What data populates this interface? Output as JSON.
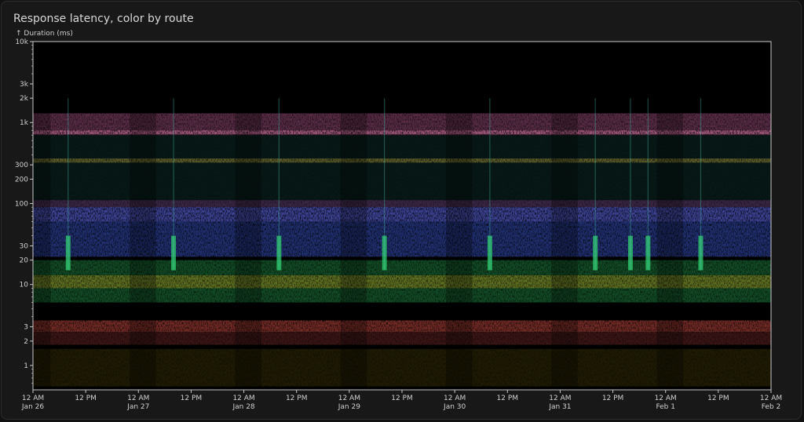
{
  "panel": {
    "title": "Response latency, color by route",
    "y_axis_title": "↑ Duration (ms)"
  },
  "colors": {
    "background": "#000000",
    "panel_bg": "#181818",
    "axis": "#c8c8c8",
    "text": "#d0d0d0"
  },
  "chart_data": {
    "type": "heatmap",
    "title": "Response latency, color by route",
    "ylabel": "↑ Duration (ms)",
    "xlabel": "",
    "y_scale": "log",
    "ylim": [
      0.5,
      10000
    ],
    "xlim": [
      "Jan 26 12 AM",
      "Feb 2 12 AM"
    ],
    "y_tick_values": [
      1,
      2,
      3,
      10,
      20,
      30,
      100,
      200,
      300,
      1000,
      2000,
      3000,
      10000
    ],
    "y_tick_labels": [
      "1",
      "2",
      "3",
      "10",
      "20",
      "30",
      "100",
      "200",
      "300",
      "1k",
      "2k",
      "3k",
      "10k"
    ],
    "x_ticks": [
      {
        "hour": 0,
        "line1": "12 AM",
        "line2": "Jan 26"
      },
      {
        "hour": 12,
        "line1": "12 PM",
        "line2": ""
      },
      {
        "hour": 24,
        "line1": "12 AM",
        "line2": "Jan 27"
      },
      {
        "hour": 36,
        "line1": "12 PM",
        "line2": ""
      },
      {
        "hour": 48,
        "line1": "12 AM",
        "line2": "Jan 28"
      },
      {
        "hour": 60,
        "line1": "12 PM",
        "line2": ""
      },
      {
        "hour": 72,
        "line1": "12 AM",
        "line2": "Jan 29"
      },
      {
        "hour": 84,
        "line1": "12 PM",
        "line2": ""
      },
      {
        "hour": 96,
        "line1": "12 AM",
        "line2": "Jan 30"
      },
      {
        "hour": 108,
        "line1": "12 PM",
        "line2": ""
      },
      {
        "hour": 120,
        "line1": "12 AM",
        "line2": "Jan 31"
      },
      {
        "hour": 132,
        "line1": "12 PM",
        "line2": ""
      },
      {
        "hour": 144,
        "line1": "12 AM",
        "line2": "Feb 1"
      },
      {
        "hour": 156,
        "line1": "12 PM",
        "line2": ""
      },
      {
        "hour": 168,
        "line1": "12 AM",
        "line2": "Feb 2"
      }
    ],
    "series": [
      {
        "color": "#e070b0",
        "y_range": [
          700,
          1300
        ],
        "intensity": 0.7
      },
      {
        "color": "#f08ab8",
        "y_range": [
          720,
          800
        ],
        "intensity": 0.85
      },
      {
        "color": "#e0b030",
        "y_range": [
          320,
          360
        ],
        "intensity": 0.8
      },
      {
        "color": "#30b0a0",
        "y_range": [
          60,
          700
        ],
        "intensity": 0.25
      },
      {
        "color": "#c050c0",
        "y_range": [
          60,
          110
        ],
        "intensity": 0.5
      },
      {
        "color": "#4060e0",
        "y_range": [
          22,
          90
        ],
        "intensity": 0.9
      },
      {
        "color": "#30c060",
        "y_range": [
          6,
          20
        ],
        "intensity": 0.7
      },
      {
        "color": "#f0c020",
        "y_range": [
          9,
          13
        ],
        "intensity": 0.6
      },
      {
        "color": "#f05a50",
        "y_range": [
          2.6,
          3.6
        ],
        "intensity": 0.85
      },
      {
        "color": "#b04040",
        "y_range": [
          1.8,
          2.6
        ],
        "intensity": 0.6
      },
      {
        "color": "#7a6a10",
        "y_range": [
          0.55,
          1.6
        ],
        "intensity": 0.45
      }
    ],
    "spikes_hours": [
      8,
      32,
      56,
      80,
      104,
      128,
      136,
      140,
      152
    ],
    "grid": false,
    "legend": "none"
  }
}
